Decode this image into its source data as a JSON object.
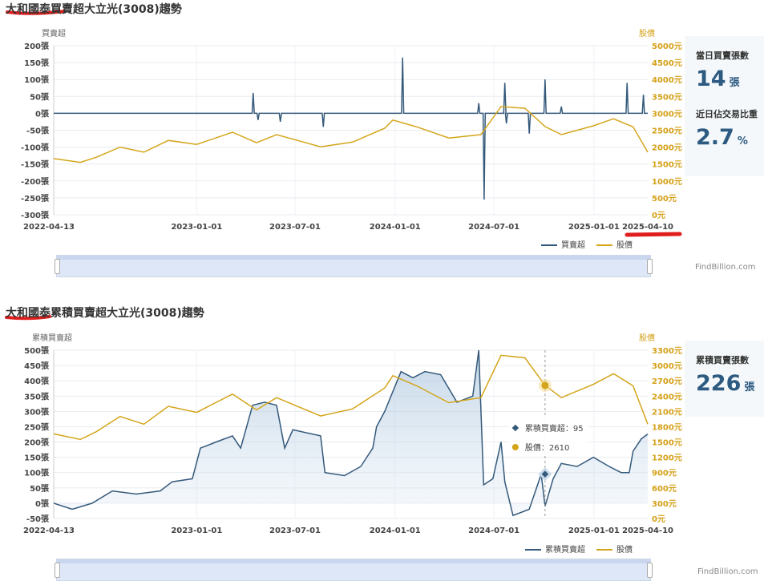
{
  "titles": [
    "大和國泰買賣超大立光(3008)趨勢",
    "大和國泰累積買賣超大立光(3008)趨勢"
  ],
  "card1": {
    "label1": "當日買賣張數",
    "value1": "14",
    "unit1": "張",
    "label2": "近日佔交易比重",
    "value2": "2.7",
    "unit2": "%"
  },
  "card2": {
    "label": "累積買賣張數",
    "value": "226",
    "unit": "張"
  },
  "brand": "FindBillion.com",
  "chart_data": [
    {
      "type": "line",
      "title": "大和國泰買賣超大立光(3008)趨勢",
      "ylabel": "買賣超",
      "y2label": "股價",
      "ylim": [
        -300,
        200
      ],
      "ystep": 50,
      "yunit": "張",
      "y2lim": [
        0,
        5000
      ],
      "y2step": 500,
      "y2unit": "元",
      "xticks": [
        {
          "day": 0,
          "label": "2022-04-13"
        },
        {
          "day": 263,
          "label": "2023-01-01"
        },
        {
          "day": 444,
          "label": "2023-07-01"
        },
        {
          "day": 628,
          "label": "2024-01-01"
        },
        {
          "day": 810,
          "label": "2024-07-01"
        },
        {
          "day": 994,
          "label": "2025-01-01"
        },
        {
          "day": 1093,
          "label": "2025-04-10"
        }
      ],
      "legend": [
        "買賣超",
        "股價"
      ],
      "grid": true,
      "series": [
        {
          "name": "買賣超",
          "color": "#34597a",
          "mode": "spikes",
          "points": [
            [
              367,
              60
            ],
            [
              376,
              -20
            ],
            [
              417,
              -25
            ],
            [
              496,
              -40
            ],
            [
              642,
              165
            ],
            [
              782,
              30
            ],
            [
              792,
              -255
            ],
            [
              830,
              90
            ],
            [
              833,
              -30
            ],
            [
              875,
              -60
            ],
            [
              904,
              100
            ],
            [
              934,
              20
            ],
            [
              1055,
              90
            ],
            [
              1085,
              55
            ]
          ]
        },
        {
          "name": "股價",
          "color": "#d4a51a",
          "axis": "right",
          "points": [
            [
              0,
              1660
            ],
            [
              49,
              1550
            ],
            [
              78,
              1700
            ],
            [
              122,
              2000
            ],
            [
              166,
              1850
            ],
            [
              211,
              2200
            ],
            [
              263,
              2080
            ],
            [
              329,
              2440
            ],
            [
              373,
              2130
            ],
            [
              410,
              2370
            ],
            [
              491,
              2010
            ],
            [
              550,
              2150
            ],
            [
              609,
              2560
            ],
            [
              624,
              2800
            ],
            [
              668,
              2600
            ],
            [
              727,
              2270
            ],
            [
              786,
              2370
            ],
            [
              823,
              3200
            ],
            [
              867,
              3150
            ],
            [
              904,
              2610
            ],
            [
              934,
              2370
            ],
            [
              993,
              2630
            ],
            [
              1030,
              2840
            ],
            [
              1066,
              2600
            ],
            [
              1093,
              1850
            ]
          ]
        }
      ]
    },
    {
      "type": "area",
      "title": "大和國泰累積買賣超大立光(3008)趨勢",
      "ylabel": "累積買賣超",
      "y2label": "股價",
      "ylim": [
        -50,
        500
      ],
      "ystep": 50,
      "yunit": "張",
      "y2lim": [
        0,
        3300
      ],
      "y2step": 300,
      "y2unit": "元",
      "xticks": [
        {
          "day": 0,
          "label": "2022-04-13"
        },
        {
          "day": 263,
          "label": "2023-01-01"
        },
        {
          "day": 444,
          "label": "2023-07-01"
        },
        {
          "day": 628,
          "label": "2024-01-01"
        },
        {
          "day": 810,
          "label": "2024-07-01"
        },
        {
          "day": 994,
          "label": "2025-01-01"
        },
        {
          "day": 1093,
          "label": "2025-04-10"
        }
      ],
      "legend": [
        "累積買賣超",
        "股價"
      ],
      "grid": true,
      "tooltip": {
        "day": 904,
        "lines": [
          "累積買賣超：95",
          "股價：2610"
        ],
        "cum": 95,
        "price": 2610
      },
      "series": [
        {
          "name": "累積買賣超",
          "color": "#34597a",
          "fill": true,
          "points": [
            [
              0,
              0
            ],
            [
              34,
              -20
            ],
            [
              71,
              0
            ],
            [
              108,
              40
            ],
            [
              152,
              30
            ],
            [
              196,
              40
            ],
            [
              218,
              70
            ],
            [
              255,
              80
            ],
            [
              270,
              180
            ],
            [
              299,
              200
            ],
            [
              329,
              220
            ],
            [
              344,
              180
            ],
            [
              366,
              320
            ],
            [
              388,
              330
            ],
            [
              410,
              320
            ],
            [
              425,
              180
            ],
            [
              440,
              240
            ],
            [
              491,
              220
            ],
            [
              499,
              100
            ],
            [
              535,
              90
            ],
            [
              565,
              120
            ],
            [
              587,
              180
            ],
            [
              594,
              250
            ],
            [
              609,
              300
            ],
            [
              639,
              430
            ],
            [
              661,
              410
            ],
            [
              683,
              430
            ],
            [
              712,
              420
            ],
            [
              742,
              330
            ],
            [
              771,
              350
            ],
            [
              782,
              500
            ],
            [
              791,
              60
            ],
            [
              808,
              80
            ],
            [
              823,
              200
            ],
            [
              830,
              70
            ],
            [
              845,
              -40
            ],
            [
              875,
              -20
            ],
            [
              897,
              95
            ],
            [
              904,
              -10
            ],
            [
              919,
              80
            ],
            [
              934,
              130
            ],
            [
              963,
              120
            ],
            [
              993,
              150
            ],
            [
              1022,
              120
            ],
            [
              1044,
              100
            ],
            [
              1059,
              100
            ],
            [
              1066,
              170
            ],
            [
              1081,
              210
            ],
            [
              1093,
              226
            ]
          ]
        },
        {
          "name": "股價",
          "color": "#d4a51a",
          "axis": "right",
          "points": [
            [
              0,
              1660
            ],
            [
              49,
              1550
            ],
            [
              78,
              1700
            ],
            [
              122,
              2000
            ],
            [
              166,
              1850
            ],
            [
              211,
              2200
            ],
            [
              263,
              2080
            ],
            [
              329,
              2440
            ],
            [
              373,
              2130
            ],
            [
              410,
              2370
            ],
            [
              491,
              2010
            ],
            [
              550,
              2150
            ],
            [
              609,
              2560
            ],
            [
              624,
              2800
            ],
            [
              668,
              2600
            ],
            [
              727,
              2270
            ],
            [
              786,
              2370
            ],
            [
              823,
              3200
            ],
            [
              867,
              3150
            ],
            [
              904,
              2610
            ],
            [
              934,
              2370
            ],
            [
              993,
              2630
            ],
            [
              1030,
              2840
            ],
            [
              1066,
              2600
            ],
            [
              1093,
              1850
            ]
          ]
        }
      ]
    }
  ]
}
